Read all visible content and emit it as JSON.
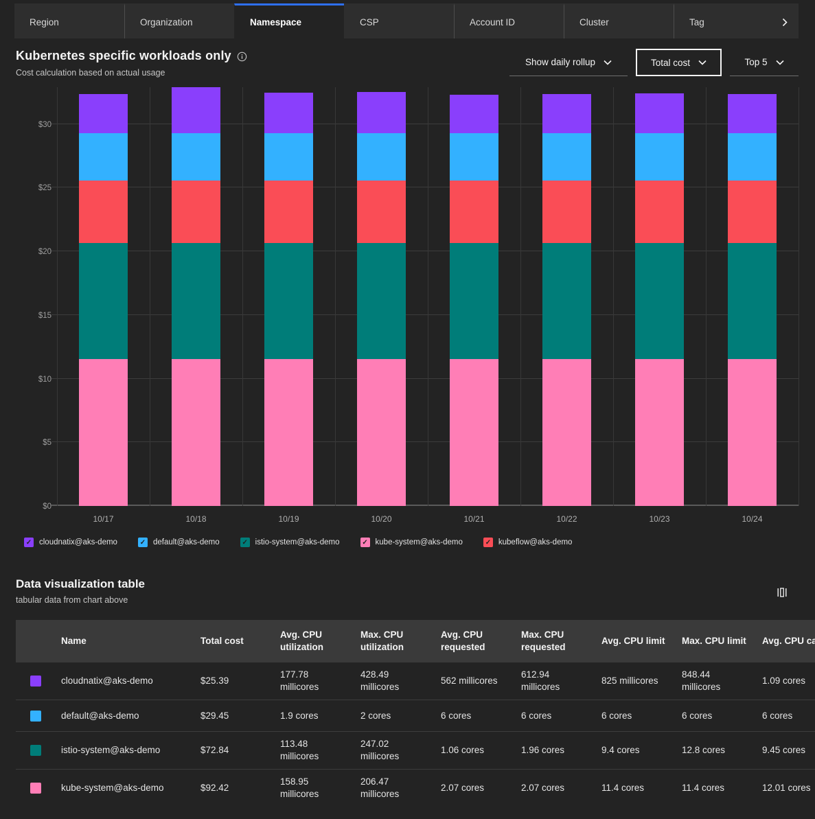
{
  "tabs": {
    "items": [
      {
        "label": "Region",
        "selected": false
      },
      {
        "label": "Organization",
        "selected": false
      },
      {
        "label": "Namespace",
        "selected": true
      },
      {
        "label": "CSP",
        "selected": false
      },
      {
        "label": "Account ID",
        "selected": false
      },
      {
        "label": "Cluster",
        "selected": false
      },
      {
        "label": "Tag",
        "selected": false,
        "overflow_icon": "chevron-right-icon"
      }
    ]
  },
  "header": {
    "title": "Kubernetes specific workloads only",
    "info_icon": "info-icon",
    "subtitle": "Cost calculation based on actual usage"
  },
  "controls": {
    "rollup_label": "Show daily rollup",
    "metric_label": "Total cost",
    "top_label": "Top 5"
  },
  "chart_data": {
    "type": "bar",
    "stacked": true,
    "title": "",
    "xlabel": "",
    "ylabel": "",
    "categories": [
      "10/17",
      "10/18",
      "10/19",
      "10/20",
      "10/21",
      "10/22",
      "10/23",
      "10/24"
    ],
    "series": [
      {
        "name": "kube-system@aks-demo",
        "color": "#ff7eb6",
        "values": [
          11.53,
          11.53,
          11.53,
          11.53,
          11.53,
          11.53,
          11.53,
          11.53
        ]
      },
      {
        "name": "istio-system@aks-demo",
        "color": "#007d79",
        "values": [
          9.13,
          9.13,
          9.13,
          9.13,
          9.13,
          9.13,
          9.13,
          9.13
        ]
      },
      {
        "name": "kubeflow@aks-demo",
        "color": "#fa4d56",
        "values": [
          4.93,
          4.93,
          4.93,
          4.93,
          4.93,
          4.93,
          4.93,
          4.93
        ]
      },
      {
        "name": "default@aks-demo",
        "color": "#33b1ff",
        "values": [
          3.69,
          3.69,
          3.69,
          3.69,
          3.69,
          3.69,
          3.69,
          3.69
        ]
      },
      {
        "name": "cloudnatix@aks-demo",
        "color": "#8a3ffc",
        "values": [
          3.1,
          3.6,
          3.2,
          3.22,
          3.05,
          3.1,
          3.14,
          3.1
        ]
      }
    ],
    "legend": [
      {
        "name": "cloudnatix@aks-demo",
        "color": "#8a3ffc"
      },
      {
        "name": "default@aks-demo",
        "color": "#33b1ff"
      },
      {
        "name": "istio-system@aks-demo",
        "color": "#007d79"
      },
      {
        "name": "kube-system@aks-demo",
        "color": "#ff7eb6"
      },
      {
        "name": "kubeflow@aks-demo",
        "color": "#fa4d56"
      }
    ],
    "legend_position": "bottom",
    "grid": true,
    "yticks": [
      0,
      5,
      10,
      15,
      20,
      25,
      30
    ],
    "ytick_prefix": "$",
    "ylim": [
      0,
      32.9
    ]
  },
  "table": {
    "title": "Data visualization table",
    "subtitle": "tabular data from chart above",
    "columns_icon": "column-settings-icon",
    "columns": [
      "Name",
      "Total cost",
      "Avg. CPU utilization",
      "Max. CPU utilization",
      "Avg. CPU requested",
      "Max. CPU requested",
      "Avg. CPU limit",
      "Max. CPU limit",
      "Avg. CPU capacity"
    ],
    "rows": [
      {
        "name": "cloudnatix@aks-demo",
        "color": "#8a3ffc",
        "values": [
          "$25.39",
          "177.78 millicores",
          "428.49 millicores",
          "562 millicores",
          "612.94 millicores",
          "825 millicores",
          "848.44 millicores",
          "1.09 cores"
        ]
      },
      {
        "name": "default@aks-demo",
        "color": "#33b1ff",
        "values": [
          "$29.45",
          "1.9 cores",
          "2 cores",
          "6 cores",
          "6 cores",
          "6 cores",
          "6 cores",
          "6 cores"
        ]
      },
      {
        "name": "istio-system@aks-demo",
        "color": "#007d79",
        "values": [
          "$72.84",
          "113.48 millicores",
          "247.02 millicores",
          "1.06 cores",
          "1.96 cores",
          "9.4 cores",
          "12.8 cores",
          "9.45 cores"
        ]
      },
      {
        "name": "kube-system@aks-demo",
        "color": "#ff7eb6",
        "values": [
          "$92.42",
          "158.95 millicores",
          "206.47 millicores",
          "2.07 cores",
          "2.07 cores",
          "11.4 cores",
          "11.4 cores",
          "12.01 cores"
        ]
      }
    ]
  }
}
